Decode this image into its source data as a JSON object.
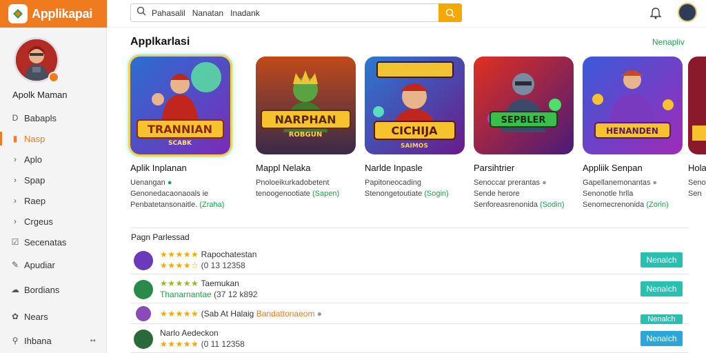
{
  "app": {
    "title": "Applikapai"
  },
  "profile": {
    "name": "Apolk Maman"
  },
  "sidebar": {
    "items": [
      {
        "label": "Babapls",
        "icon": "d-icon"
      },
      {
        "label": "Nasp",
        "icon": "bookmark-icon",
        "active": true
      },
      {
        "label": "Aplo",
        "icon": "chevron-right-icon"
      },
      {
        "label": "Spap",
        "icon": "chevron-right-icon"
      },
      {
        "label": "Raep",
        "icon": "chevron-right-icon"
      },
      {
        "label": "Crgeus",
        "icon": "chevron-right-icon"
      },
      {
        "label": "Secenatas",
        "icon": "check-box-icon"
      },
      {
        "label": "Apudiar",
        "icon": "pen-icon"
      },
      {
        "label": "Bordians",
        "icon": "cloud-icon"
      },
      {
        "label": "Nears",
        "icon": "gear-icon"
      },
      {
        "label": "Ihbana",
        "icon": "person-icon",
        "dots": "••"
      }
    ]
  },
  "search": {
    "value": "Pahasalil   Nanatan   Inadank"
  },
  "main": {
    "section_title": "Applkarlasi",
    "see_all": "Nenapliv",
    "cards": [
      {
        "art": "TRANNIAN",
        "art_sub": "SCABK",
        "name": "Aplik Inplanan",
        "sub": "Uenangan",
        "desc1": "Genonedacaonaoals ie",
        "desc2": "Penbatetansonaitle.",
        "tag": "(Zraha)"
      },
      {
        "art": "NARPHAN",
        "art_sub": "ROBGUN",
        "name": "Mappl Nelaka",
        "sub": "",
        "desc1": "Pnoloeikurkadobetent",
        "desc2": "tenoogenootiate",
        "tag": "(Sapen)"
      },
      {
        "art": "CICHIJA",
        "art_sub": "SAIMOS",
        "name": "Narlde Inpasle",
        "sub": "",
        "desc1": "Papitoneocading",
        "desc2": "Stenongetoutiate",
        "tag": "(Sogin)"
      },
      {
        "art": "SEPBLER",
        "art_sub": "",
        "name": "Parsihtrier",
        "sub": "",
        "desc1": "Senoccar prerantas",
        "desc2": "Sende herore",
        "desc3": "Senforeasrenonida",
        "tag": "(Sodin)"
      },
      {
        "art": "HENANDEN",
        "art_sub": "",
        "name": "Appliik Senpan",
        "sub": "",
        "desc1": "Gapellanemonantas",
        "desc2": "Senonotle hrlla",
        "desc3": "Senomecrenonida",
        "tag": "(Zorin)"
      },
      {
        "art": "",
        "art_sub": "",
        "name": "Hola",
        "sub": "",
        "desc1": "Seno",
        "desc2": "Sen",
        "tag": ""
      }
    ]
  },
  "list": {
    "title": "Pagn Parlessad",
    "rows": [
      {
        "line1": "Rapochatestan",
        "stars1": "★★★★★",
        "stars2": "★★★★☆",
        "line2": "(0 13 12358",
        "button": "Nenalch"
      },
      {
        "line1": "Taemukan",
        "stars1": "★★★★★",
        "line2prefix": "Thanarnantae",
        "line2": "(37 12 k892",
        "button": "Nenalch"
      },
      {
        "line1": "",
        "stars1": "★★★★★",
        "line2prefix": "(Sab At Halaig",
        "line2": "Bandattonaeom",
        "button": "Nenalch"
      },
      {
        "line1": "Narlo Aedeckon",
        "stars1": "★★★★★",
        "line2": "(0 11 12358",
        "button": "Nenalch"
      }
    ]
  }
}
